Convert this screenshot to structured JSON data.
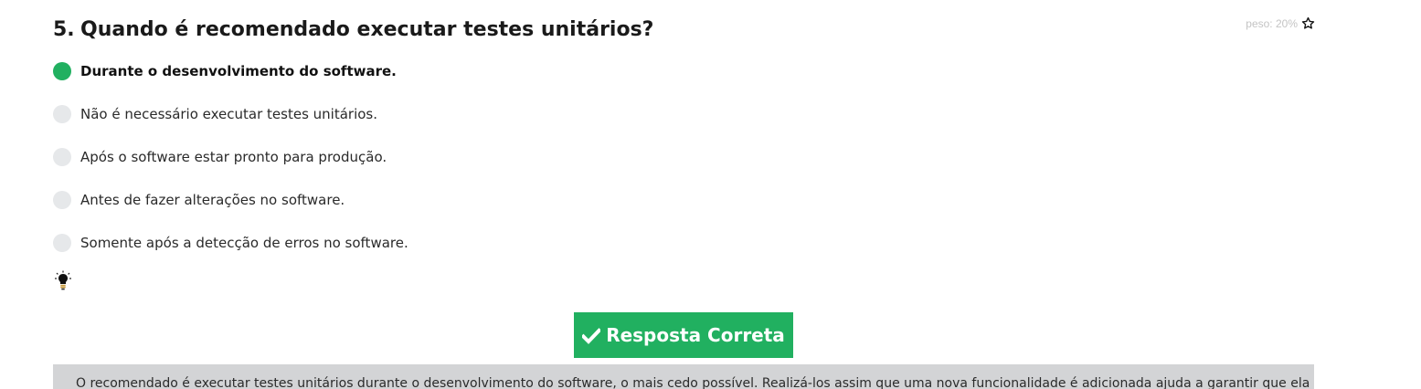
{
  "question": {
    "number": "5.",
    "text": "Quando é recomendado executar testes unitários?",
    "weight_label": "peso: 20%",
    "weight_icon": "star-outline-icon"
  },
  "options": [
    {
      "label": "Durante o desenvolvimento do software.",
      "selected": true
    },
    {
      "label": "Não é necessário executar testes unitários.",
      "selected": false
    },
    {
      "label": "Após o software estar pronto para produção.",
      "selected": false
    },
    {
      "label": "Antes de fazer alterações no software.",
      "selected": false
    },
    {
      "label": "Somente após a detecção de erros no software.",
      "selected": false
    }
  ],
  "hint": {
    "icon": "lightbulb-icon"
  },
  "result": {
    "label": "Resposta Correta",
    "icon": "check-icon",
    "color": "#21b060"
  },
  "explanation": {
    "text": "O recomendado é executar testes unitários durante o desenvolvimento do software, o mais cedo possível. Realizá-los assim que uma nova funcionalidade é adicionada ajuda a garantir que ela esteja"
  },
  "colors": {
    "accent": "#21b060",
    "radio_unselected": "#e6e8ea",
    "explanation_bg": "#d3d4d6"
  }
}
